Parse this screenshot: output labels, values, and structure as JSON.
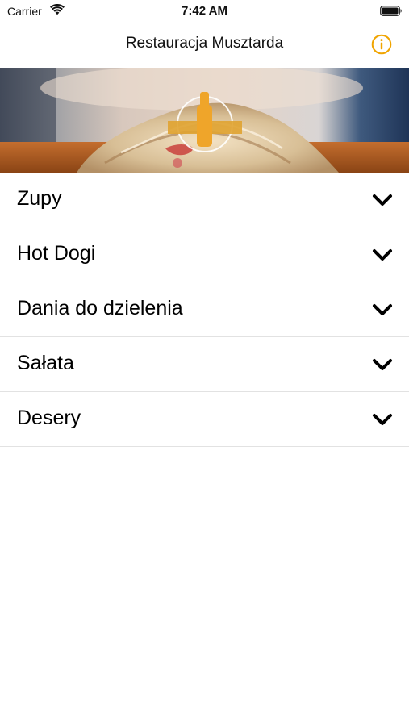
{
  "status_bar": {
    "carrier": "Carrier",
    "time": "7:42 AM",
    "wifi_icon": "wifi-icon",
    "battery_icon": "battery-icon"
  },
  "nav_bar": {
    "title": "Restauracja Musztarda",
    "info_icon": "info-icon",
    "accent_color": "#f0a400"
  },
  "banner": {
    "description_icon": "restaurant-logo"
  },
  "categories": [
    {
      "label": "Zupy",
      "icon": "chevron-down-icon"
    },
    {
      "label": "Hot Dogi",
      "icon": "chevron-down-icon"
    },
    {
      "label": "Dania do dzielenia",
      "icon": "chevron-down-icon"
    },
    {
      "label": "Sałata",
      "icon": "chevron-down-icon"
    },
    {
      "label": "Desery",
      "icon": "chevron-down-icon"
    }
  ]
}
